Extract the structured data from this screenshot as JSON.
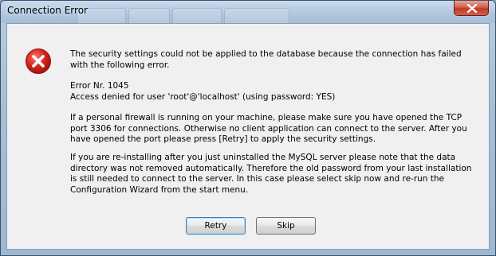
{
  "window": {
    "title": "Connection Error"
  },
  "message": {
    "icon": "error-icon",
    "paragraph1": "The security settings could not be applied to the database because the connection has failed\nwith the following error.",
    "paragraph2": "Error Nr. 1045\nAccess denied for user 'root'@'localhost' (using password: YES)",
    "paragraph3": "If a personal firewall is running on your machine, please make sure you have opened the TCP\nport 3306 for connections. Otherwise no client application can connect to the server. After you\nhave opened the port please press [Retry] to apply the security settings.",
    "paragraph4": "If you are re-installing after you just uninstalled the MySQL server please note that the data\ndirectory was not removed automatically. Therefore the old password from your last installation\nis still needed to connect to the server. In this case please select skip now and re-run the\nConfiguration Wizard from the start menu."
  },
  "buttons": {
    "retry_label": "Retry",
    "skip_label": "Skip"
  },
  "colors": {
    "error_red": "#d6231c",
    "close_red": "#c03a22",
    "title_bar": "#b4c9e0"
  }
}
